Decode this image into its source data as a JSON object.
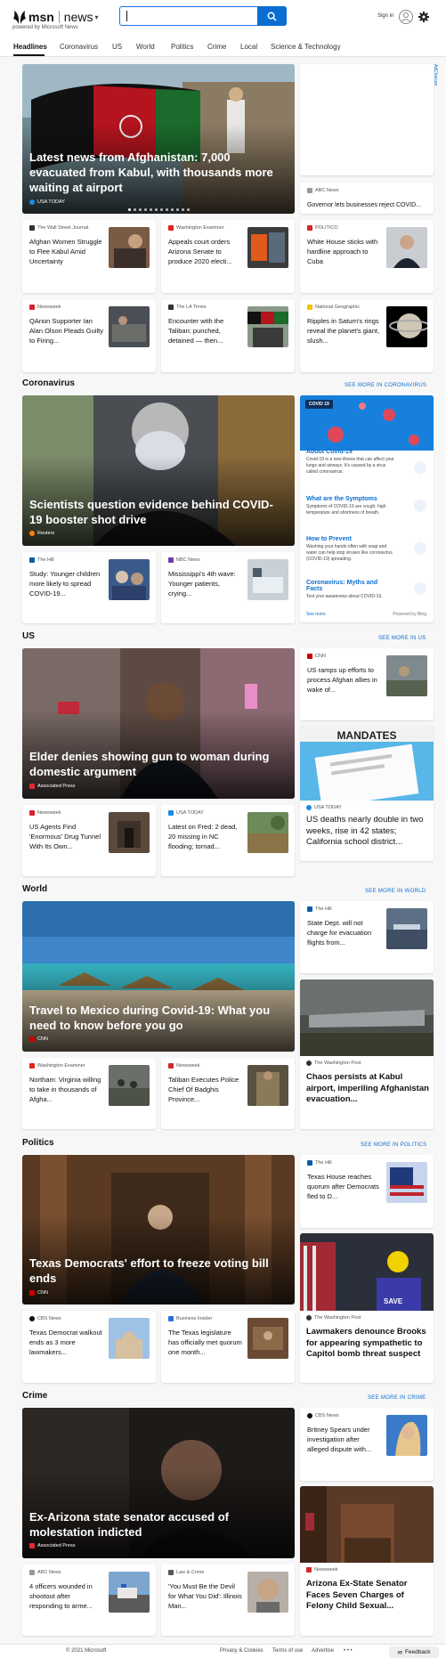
{
  "header": {
    "logo_brand": "msn",
    "logo_section": "news",
    "powered_by": "powered by Microsoft News",
    "sign_in": "Sign in",
    "search_value": ""
  },
  "nav": [
    "Headlines",
    "Coronavirus",
    "US",
    "World",
    "Politics",
    "Crime",
    "Local",
    "Science & Technology"
  ],
  "ad_choices": "AdChoices",
  "top": {
    "hero": {
      "title": "Latest news from Afghanistan: 7,000 evacuated from Kabul, with thousands more waiting at airport",
      "source": "USA TODAY"
    },
    "side_card": {
      "source": "ABC News",
      "headline": "Governor lets businesses reject COVID..."
    },
    "cards": [
      {
        "source": "The Wall Street Journal.",
        "headline": "Afghan Women Struggle to Flee Kabul Amid Uncertainty"
      },
      {
        "source": "Washington Examiner",
        "headline": "Appeals court orders Arizona Senate to produce 2020 electi..."
      },
      {
        "source": "POLITICO",
        "headline": "White House sticks with hardline approach to Cuba"
      },
      {
        "source": "Newsweek",
        "headline": "QAnon Supporter Ian Alan Olson Pleads Guilty to Firing..."
      },
      {
        "source": "The LA Times",
        "headline": "Encounter with the Taliban: punched, detained — then..."
      },
      {
        "source": "National Geographic",
        "headline": "Ripples in Saturn's rings reveal the planet's giant, slush..."
      }
    ]
  },
  "coronavirus": {
    "heading": "Coronavirus",
    "see_more": "SEE MORE IN CORONAVIRUS",
    "hero": {
      "title": "Scientists question evidence behind COVID-19 booster shot drive",
      "source": "Reuters"
    },
    "cards": [
      {
        "source": "The Hill",
        "headline": "Study: Younger children more likely to spread COVID-19..."
      },
      {
        "source": "NBC News",
        "headline": "Mississippi's 4th wave: Younger patients, crying..."
      }
    ],
    "panel": {
      "tag": "COVID 19",
      "items": [
        {
          "title": "About Covid-19",
          "desc": "Covid-19 is a new illness that can affect your lungs and airways. It's caused by a virus called coronavirus."
        },
        {
          "title": "What are the Symptoms",
          "desc": "Symptoms of COVID-19 are cough, high temperature and shortness of breath."
        },
        {
          "title": "How to Prevent",
          "desc": "Washing your hands often with soap and water can help stop viruses like coronavirus (COVID-19) spreading."
        },
        {
          "title": "Coronavirus: Myths and Facts",
          "desc": "Test your awareness about COVID-19."
        }
      ],
      "see_more": "See more",
      "powered": "Powered by Bing"
    }
  },
  "us": {
    "heading": "US",
    "see_more": "SEE MORE IN US",
    "hero": {
      "title": "Elder denies showing gun to woman during domestic argument",
      "source": "Associated Press"
    },
    "side_card": {
      "source": "CNN",
      "headline": "US ramps up efforts to process Afghan allies in wake of..."
    },
    "tall_card": {
      "source": "USA TODAY",
      "headline": "US deaths nearly double in two weeks, rise in 42 states; California school district...",
      "image_text": "MANDATES"
    },
    "cards": [
      {
        "source": "Newsweek",
        "headline": "US Agents Find 'Enormous' Drug Tunnel With Its Own..."
      },
      {
        "source": "USA TODAY",
        "headline": "Latest on Fred: 2 dead, 20 missing in NC flooding; tornad..."
      }
    ]
  },
  "world": {
    "heading": "World",
    "see_more": "SEE MORE IN WORLD",
    "hero": {
      "title": "Travel to Mexico during Covid-19: What you need to know before you go",
      "source": "CNN"
    },
    "side_card": {
      "source": "The Hill",
      "headline": "State Dept. will not charge for evacuation flights from..."
    },
    "tall_card": {
      "source": "The Washington Post",
      "headline": "Chaos persists at Kabul airport, imperiling Afghanistan evacuation..."
    },
    "cards": [
      {
        "source": "Washington Examiner",
        "headline": "Northam: Virginia willing to take in thousands of Afgha..."
      },
      {
        "source": "Newsweek",
        "headline": "Taliban Executes Police Chief Of Badghis Province..."
      }
    ]
  },
  "politics": {
    "heading": "Politics",
    "see_more": "SEE MORE IN POLITICS",
    "hero": {
      "title": "Texas Democrats' effort to freeze voting bill ends",
      "source": "CNN"
    },
    "side_card": {
      "source": "The Hill",
      "headline": "Texas House reaches quorum after Democrats fled to D..."
    },
    "tall_card": {
      "source": "The Washington Post",
      "headline": "Lawmakers denounce Brooks for appearing sympathetic to Capitol bomb threat suspect",
      "image_text": "SAVE"
    },
    "cards": [
      {
        "source": "CBS News",
        "headline": "Texas Democrat walkout ends as 3 more lawmakers..."
      },
      {
        "source": "Business Insider",
        "headline": "The Texas legislature has officially met quorum one month..."
      }
    ]
  },
  "crime": {
    "heading": "Crime",
    "see_more": "SEE MORE IN CRIME",
    "hero": {
      "title": "Ex-Arizona state senator accused of molestation indicted",
      "source": "Associated Press"
    },
    "side_card": {
      "source": "CBS News",
      "headline": "Britney Spears under investigation after alleged dispute with..."
    },
    "tall_card": {
      "source": "Newsweek",
      "headline": "Arizona Ex-State Senator Faces Seven Charges of Felony Child Sexual..."
    },
    "cards": [
      {
        "source": "ABC News",
        "headline": "4 officers wounded in shootout after responding to arme..."
      },
      {
        "source": "Law & Crime",
        "headline": "'You Must Be the Devil for What You Did': Illinois Man..."
      }
    ]
  },
  "footer": {
    "copyright": "© 2021 Microsoft",
    "privacy": "Privacy & Cookies",
    "terms": "Terms of use",
    "advertise": "Advertise",
    "more": "• • •",
    "feedback": "Feedback"
  }
}
